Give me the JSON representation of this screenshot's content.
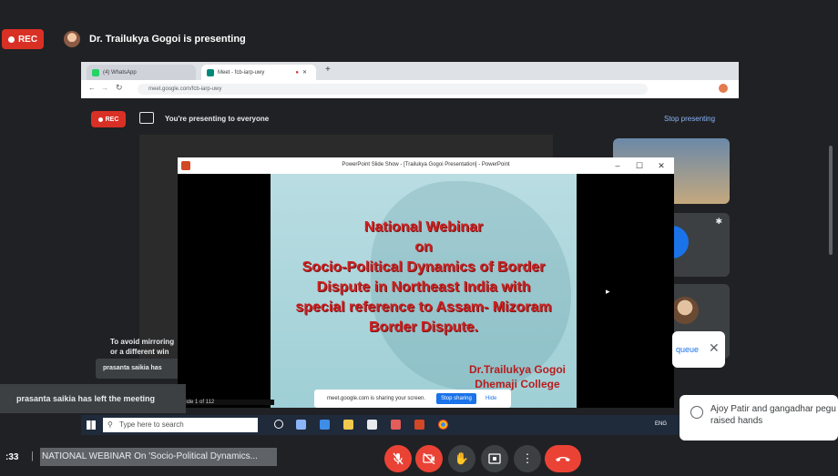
{
  "meet": {
    "rec_label": "REC",
    "presenter_text": "Dr. Trailukya Gogoi is presenting"
  },
  "browser": {
    "tab1_label": "(4) WhatsApp",
    "tab2_label": "Meet - fcb-iarp-uwy",
    "new_tab": "+",
    "url": "meet.google.com/fcb-iarp-uwy"
  },
  "inner_meet": {
    "rec_label": "REC",
    "presenting_text": "You're presenting to everyone",
    "stop_presenting": "Stop presenting",
    "mirror_line1": "To avoid mirroring",
    "mirror_line2": "or a different win",
    "toast": "prasanta saikia has"
  },
  "ppt": {
    "window_title": "PowerPoint Slide Show - [Trailukya Gogoi Presentation] - PowerPoint",
    "minimize": "–",
    "maximize": "☐",
    "close": "✕",
    "slide_title_lines": [
      "National Webinar",
      "on",
      "Socio-Political Dynamics of Border",
      "Dispute in Northeast India with",
      "special reference to Assam- Mizoram",
      "Border Dispute."
    ],
    "author_line1": "Dr.Trailukya Gogoi",
    "author_line2": "Dhemaji College",
    "share_text": "meet.google.com is sharing your screen.",
    "stop_sharing": "Stop sharing",
    "hide": "Hide",
    "slide_counter": "Slide 1 of 112"
  },
  "taskbar": {
    "search_placeholder": "Type here to search",
    "lang": "ENG"
  },
  "notifications": {
    "left_meeting": "prasanta saikia has left the meeting",
    "raised_hands": "Ajoy Patir and gangadhar pegu raised hands",
    "queue_label": "queue",
    "queue_close": "✕"
  },
  "bottom": {
    "clock": ":33",
    "separator": "|",
    "meeting_name": "NATIONAL WEBINAR On 'Socio-Political Dynamics..."
  },
  "icons": {
    "mic": "mic-off-icon",
    "cam": "camera-off-icon",
    "hand": "raise-hand-icon",
    "present": "present-now-icon",
    "more": "more-options-icon",
    "end": "end-call-icon"
  },
  "colors": {
    "rec_red": "#d93025",
    "meet_bg": "#202124",
    "link_blue": "#8ab4f8",
    "slide_title_red": "#cc2222"
  }
}
